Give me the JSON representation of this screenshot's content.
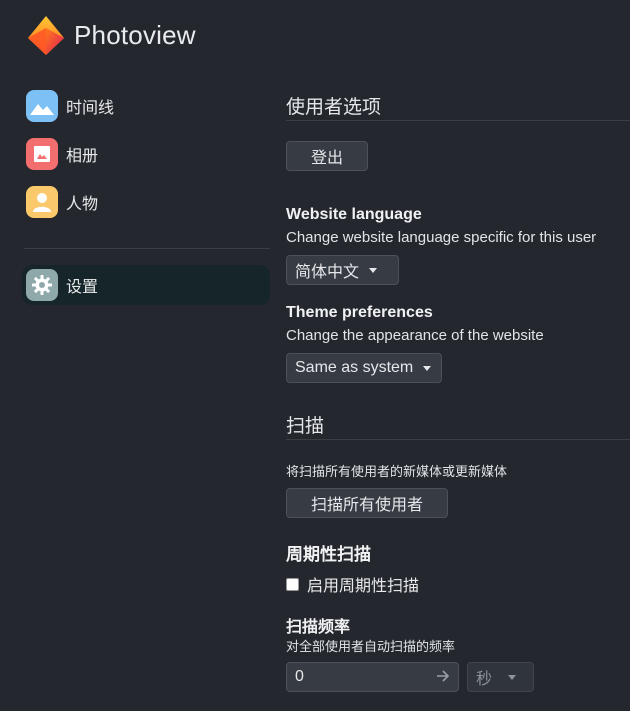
{
  "app": {
    "title": "Photoview"
  },
  "sidebar": {
    "items": [
      {
        "label": "时间线",
        "icon": "timeline-icon",
        "color": "#7cc0f5"
      },
      {
        "label": "相册",
        "icon": "album-icon",
        "color": "#f36f6f"
      },
      {
        "label": "人物",
        "icon": "people-icon",
        "color": "#fbc86c"
      }
    ],
    "settings": {
      "label": "设置",
      "icon": "gear-icon",
      "color": "#8fa9ab"
    }
  },
  "user_prefs": {
    "title": "使用者选项",
    "logout_label": "登出",
    "language": {
      "title": "Website language",
      "description": "Change website language specific for this user",
      "selected": "简体中文"
    },
    "theme": {
      "title": "Theme preferences",
      "description": "Change the appearance of the website",
      "selected": "Same as system"
    }
  },
  "scan": {
    "title": "扫描",
    "description": "将扫描所有使用者的新媒体或更新媒体",
    "scan_all_label": "扫描所有使用者",
    "periodic": {
      "title": "周期性扫描",
      "checkbox_label": "启用周期性扫描",
      "checked": false
    },
    "frequency": {
      "title": "扫描频率",
      "description": "对全部使用者自动扫描的频率",
      "value": "0",
      "unit": "秒"
    }
  },
  "colors": {
    "background": "#24282e",
    "active_nav": "#15252a",
    "button": "#373c44"
  }
}
